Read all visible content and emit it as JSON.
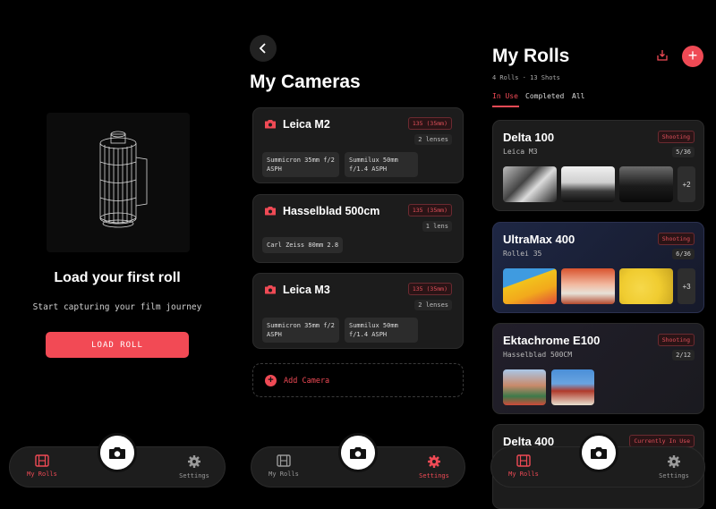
{
  "screen1": {
    "title": "Load your first roll",
    "subtitle": "Start capturing your film journey",
    "button": "LOAD ROLL",
    "tabs": {
      "left": "My Rolls",
      "right": "Settings"
    }
  },
  "screen2": {
    "title": "My Cameras",
    "cameras": [
      {
        "name": "Leica M2",
        "format": "135 (35mm)",
        "lens_count": "2 lenses",
        "lenses": [
          "Summicron 35mm f/2 ASPH",
          "Summilux 50mm f/1.4 ASPH"
        ]
      },
      {
        "name": "Hasselblad 500cm",
        "format": "135 (35mm)",
        "lens_count": "1 lens",
        "lenses": [
          "Carl Zeiss 80mm 2.8"
        ]
      },
      {
        "name": "Leica M3",
        "format": "135 (35mm)",
        "lens_count": "2 lenses",
        "lenses": [
          "Summicron 35mm f/2 ASPH",
          "Summilux 50mm f/1.4 ASPH"
        ]
      }
    ],
    "add_camera": "Add Camera",
    "tabs": {
      "left": "My Rolls",
      "right": "Settings"
    }
  },
  "screen3": {
    "title": "My Rolls",
    "meta": "4 Rolls · 13 Shots",
    "segments": [
      "In Use",
      "Completed",
      "All"
    ],
    "rolls": [
      {
        "name": "Delta 100",
        "camera": "Leica M3",
        "status": "Shooting",
        "count": "5/36",
        "more": "+2"
      },
      {
        "name": "UltraMax 400",
        "camera": "Rollei 35",
        "status": "Shooting",
        "count": "6/36",
        "more": "+3"
      },
      {
        "name": "Ektachrome E100",
        "camera": "Hasselblad 500CM",
        "status": "Shooting",
        "count": "2/12"
      },
      {
        "name": "Delta 400",
        "camera": "",
        "status": "Currently In Use",
        "count": ""
      }
    ],
    "tabs": {
      "left": "My Rolls",
      "right": "Settings"
    }
  },
  "colors": {
    "accent": "#ef4a55",
    "background": "#000000",
    "card": "#1c1c1c"
  },
  "icons": [
    "film-canister-icon",
    "camera-icon",
    "film-strip-icon",
    "gear-icon",
    "chevron-left-icon",
    "download-icon",
    "plus-icon"
  ]
}
